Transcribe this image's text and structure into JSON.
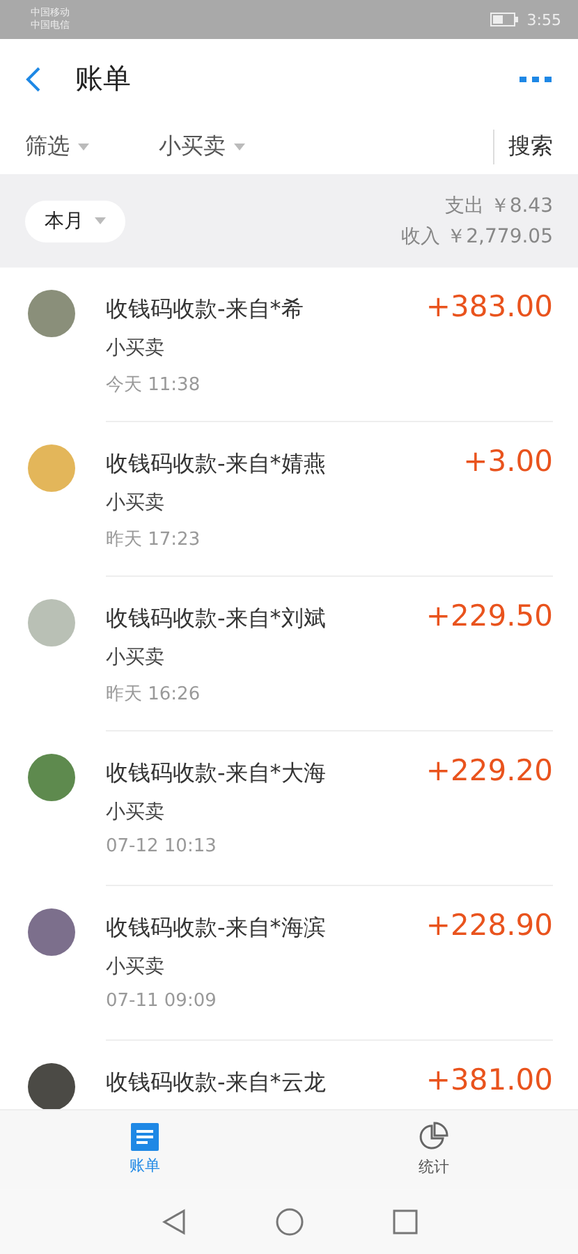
{
  "status_bar": {
    "carriers": [
      "中国移动",
      "中国电信"
    ],
    "time": "3:55"
  },
  "header": {
    "title": "账单"
  },
  "filters": {
    "items": [
      "筛选",
      "小买卖"
    ],
    "search": "搜索"
  },
  "summary": {
    "period": "本月",
    "expense": "支出 ￥8.43",
    "income": "收入 ￥2,779.05"
  },
  "transactions": [
    {
      "title": "收钱码收款-来自*希",
      "amount": "+383.00",
      "category": "小买卖",
      "time": "今天  11:38",
      "color": "#8a8f7a"
    },
    {
      "title": "收钱码收款-来自*婧燕",
      "amount": "+3.00",
      "category": "小买卖",
      "time": "昨天  17:23",
      "color": "#e3b65a"
    },
    {
      "title": "收钱码收款-来自*刘斌",
      "amount": "+229.50",
      "category": "小买卖",
      "time": "昨天  16:26",
      "color": "#b9c0b5"
    },
    {
      "title": "收钱码收款-来自*大海",
      "amount": "+229.20",
      "category": "小买卖",
      "time": "07-12  10:13",
      "color": "#5e8a4e"
    },
    {
      "title": "收钱码收款-来自*海滨",
      "amount": "+228.90",
      "category": "小买卖",
      "time": "07-11  09:09",
      "color": "#7c6f8c"
    },
    {
      "title": "收钱码收款-来自*云龙",
      "amount": "+381.00",
      "color": "#4b4a45"
    }
  ],
  "tabs": [
    {
      "label": "账单",
      "selected": true,
      "kind": "bill"
    },
    {
      "label": "统计",
      "selected": false,
      "kind": "stats"
    }
  ]
}
